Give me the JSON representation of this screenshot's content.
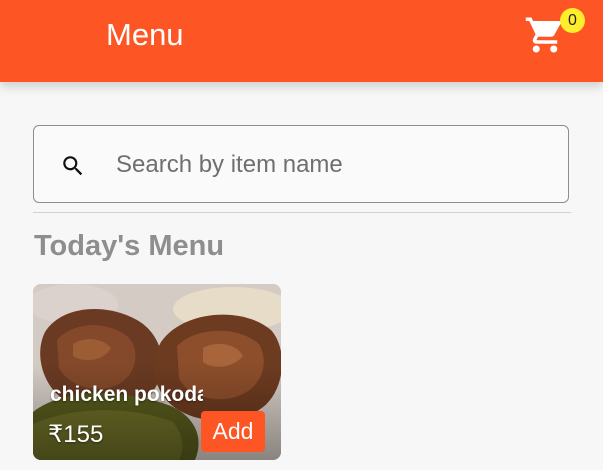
{
  "app_bar": {
    "title": "Menu",
    "cart_icon": "shopping-cart-icon",
    "cart_count": "0"
  },
  "search": {
    "icon": "search-icon",
    "placeholder": "Search by item name",
    "value": ""
  },
  "section": {
    "title": "Today's Menu"
  },
  "items": [
    {
      "name": "chicken pokoda",
      "price": "₹155",
      "add_label": "Add"
    }
  ],
  "colors": {
    "primary": "#fd5523",
    "badge": "#ffee2b",
    "background": "#f7f7f7",
    "section_title": "#8e8e8e"
  }
}
